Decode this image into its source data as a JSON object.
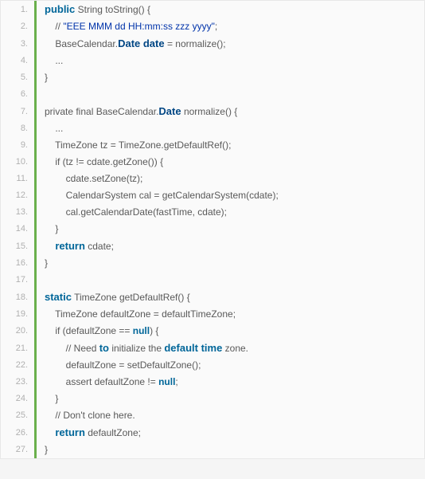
{
  "lines": [
    {
      "n": "1.",
      "indent": 0,
      "segs": [
        {
          "t": "public",
          "c": "kw-strong"
        },
        {
          "t": " String toString() {"
        }
      ]
    },
    {
      "n": "2.",
      "indent": 1,
      "segs": [
        {
          "t": "// "
        },
        {
          "t": "\"EEE MMM dd HH:mm:ss zzz yyyy\"",
          "c": "str"
        },
        {
          "t": ";"
        }
      ]
    },
    {
      "n": "3.",
      "indent": 1,
      "segs": [
        {
          "t": "BaseCalendar."
        },
        {
          "t": "Date date",
          "c": "tok-strong"
        },
        {
          "t": " = normalize();"
        }
      ]
    },
    {
      "n": "4.",
      "indent": 1,
      "segs": [
        {
          "t": "..."
        }
      ]
    },
    {
      "n": "5.",
      "indent": 0,
      "segs": [
        {
          "t": "}"
        }
      ]
    },
    {
      "n": "6.",
      "indent": 0,
      "segs": [
        {
          "t": " "
        }
      ]
    },
    {
      "n": "7.",
      "indent": 0,
      "segs": [
        {
          "t": "private final BaseCalendar."
        },
        {
          "t": "Date",
          "c": "tok-strong"
        },
        {
          "t": " normalize() {"
        }
      ]
    },
    {
      "n": "8.",
      "indent": 1,
      "segs": [
        {
          "t": "..."
        }
      ]
    },
    {
      "n": "9.",
      "indent": 1,
      "segs": [
        {
          "t": "TimeZone tz = TimeZone.getDefaultRef();"
        }
      ]
    },
    {
      "n": "10.",
      "indent": 1,
      "segs": [
        {
          "t": "if (tz != cdate.getZone()) {"
        }
      ]
    },
    {
      "n": "11.",
      "indent": 2,
      "segs": [
        {
          "t": "cdate.setZone(tz);"
        }
      ]
    },
    {
      "n": "12.",
      "indent": 2,
      "segs": [
        {
          "t": "CalendarSystem cal = getCalendarSystem(cdate);"
        }
      ]
    },
    {
      "n": "13.",
      "indent": 2,
      "segs": [
        {
          "t": "cal.getCalendarDate(fastTime, cdate);"
        }
      ]
    },
    {
      "n": "14.",
      "indent": 1,
      "segs": [
        {
          "t": "}"
        }
      ]
    },
    {
      "n": "15.",
      "indent": 1,
      "segs": [
        {
          "t": "return",
          "c": "kw-strong"
        },
        {
          "t": " cdate;"
        }
      ]
    },
    {
      "n": "16.",
      "indent": 0,
      "segs": [
        {
          "t": "}"
        }
      ]
    },
    {
      "n": "17.",
      "indent": 0,
      "segs": [
        {
          "t": " "
        }
      ]
    },
    {
      "n": "18.",
      "indent": 0,
      "segs": [
        {
          "t": "static",
          "c": "kw-strong"
        },
        {
          "t": " TimeZone getDefaultRef() {"
        }
      ]
    },
    {
      "n": "19.",
      "indent": 1,
      "segs": [
        {
          "t": "TimeZone defaultZone = defaultTimeZone;"
        }
      ]
    },
    {
      "n": "20.",
      "indent": 1,
      "segs": [
        {
          "t": "if (defaultZone == "
        },
        {
          "t": "null",
          "c": "kw"
        },
        {
          "t": ") {"
        }
      ]
    },
    {
      "n": "21.",
      "indent": 2,
      "segs": [
        {
          "t": "// Need "
        },
        {
          "t": "to",
          "c": "kw-strong"
        },
        {
          "t": " initialize the "
        },
        {
          "t": "default time",
          "c": "kw-strong"
        },
        {
          "t": " zone."
        }
      ]
    },
    {
      "n": "22.",
      "indent": 2,
      "segs": [
        {
          "t": "defaultZone = setDefaultZone();"
        }
      ]
    },
    {
      "n": "23.",
      "indent": 2,
      "segs": [
        {
          "t": "assert defaultZone != "
        },
        {
          "t": "null",
          "c": "kw"
        },
        {
          "t": ";"
        }
      ]
    },
    {
      "n": "24.",
      "indent": 1,
      "segs": [
        {
          "t": "}"
        }
      ]
    },
    {
      "n": "25.",
      "indent": 1,
      "segs": [
        {
          "t": "// Don't clone here."
        }
      ]
    },
    {
      "n": "26.",
      "indent": 1,
      "segs": [
        {
          "t": "return",
          "c": "kw-strong"
        },
        {
          "t": " defaultZone;"
        }
      ]
    },
    {
      "n": "27.",
      "indent": 0,
      "segs": [
        {
          "t": "}"
        }
      ]
    }
  ]
}
